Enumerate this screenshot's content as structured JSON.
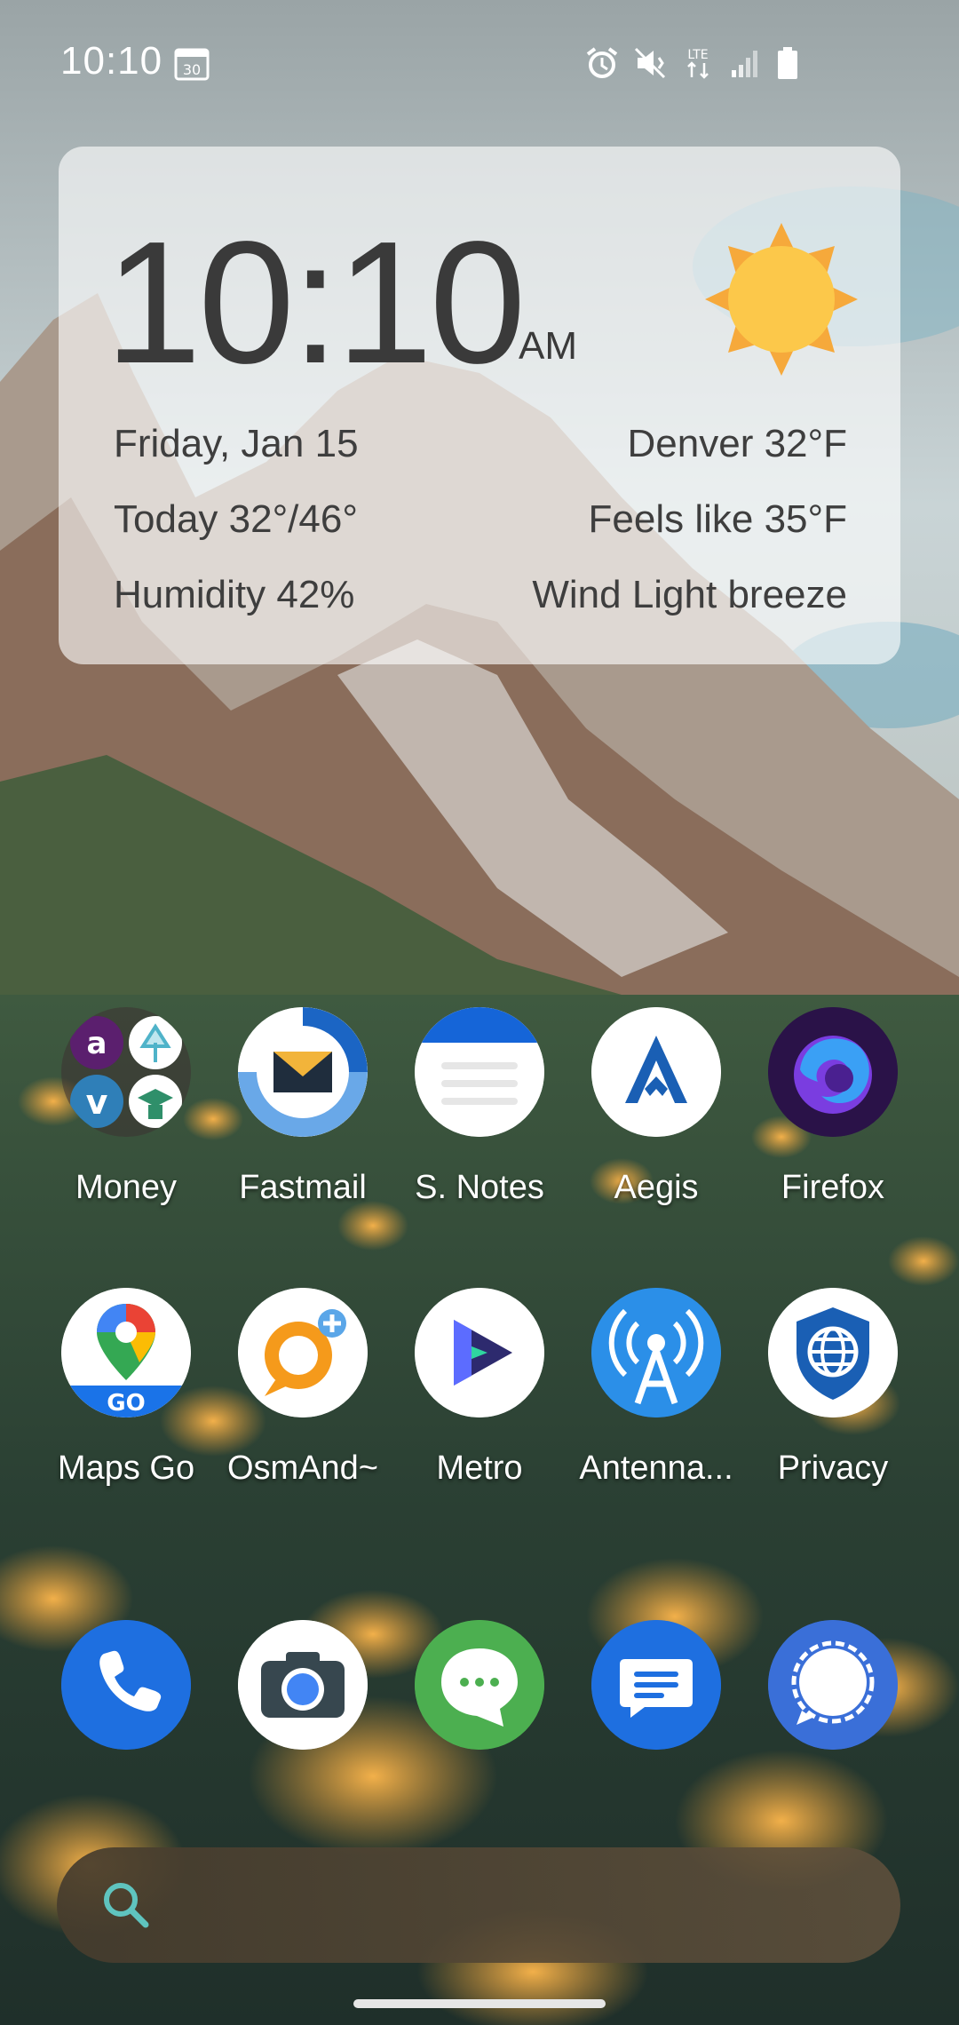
{
  "status_bar": {
    "time": "10:10",
    "calendar_day": "30",
    "network": "LTE",
    "icons": [
      "alarm-icon",
      "vibrate-icon",
      "lte-icon",
      "signal-icon",
      "battery-icon"
    ]
  },
  "widget": {
    "time": "10:10",
    "ampm": "AM",
    "date": "Friday, Jan 15",
    "location_temp": "Denver 32°F",
    "today_range": "Today 32°/46°",
    "feels_like": "Feels like 35°F",
    "humidity": "Humidity 42%",
    "wind": "Wind Light breeze",
    "weather_icon": "sun-icon"
  },
  "apps_row1": [
    {
      "label": "Money",
      "icon": "money-folder-icon"
    },
    {
      "label": "Fastmail",
      "icon": "fastmail-icon"
    },
    {
      "label": "S. Notes",
      "icon": "notes-icon"
    },
    {
      "label": "Aegis",
      "icon": "aegis-icon"
    },
    {
      "label": "Firefox",
      "icon": "firefox-icon"
    }
  ],
  "apps_row2": [
    {
      "label": "Maps Go",
      "icon": "maps-go-icon",
      "badge": "GO"
    },
    {
      "label": "OsmAnd~",
      "icon": "osmand-icon"
    },
    {
      "label": "Metro",
      "icon": "metro-icon"
    },
    {
      "label": "Antenna...",
      "icon": "antenna-icon"
    },
    {
      "label": "Privacy",
      "icon": "privacy-icon"
    }
  ],
  "dock": [
    {
      "name": "phone",
      "icon": "phone-icon"
    },
    {
      "name": "camera",
      "icon": "camera-icon"
    },
    {
      "name": "chat",
      "icon": "chat-icon"
    },
    {
      "name": "messages",
      "icon": "messages-icon"
    },
    {
      "name": "signal",
      "icon": "signal-app-icon"
    }
  ],
  "folder_badges": [
    "a",
    "v"
  ],
  "colors": {
    "widget_bg": "#ffffffa0",
    "sun": "#fcc84a",
    "phone_blue": "#1e6fe0",
    "firefox_purple": "#3b1c6e",
    "chat_green": "#4caf50"
  }
}
